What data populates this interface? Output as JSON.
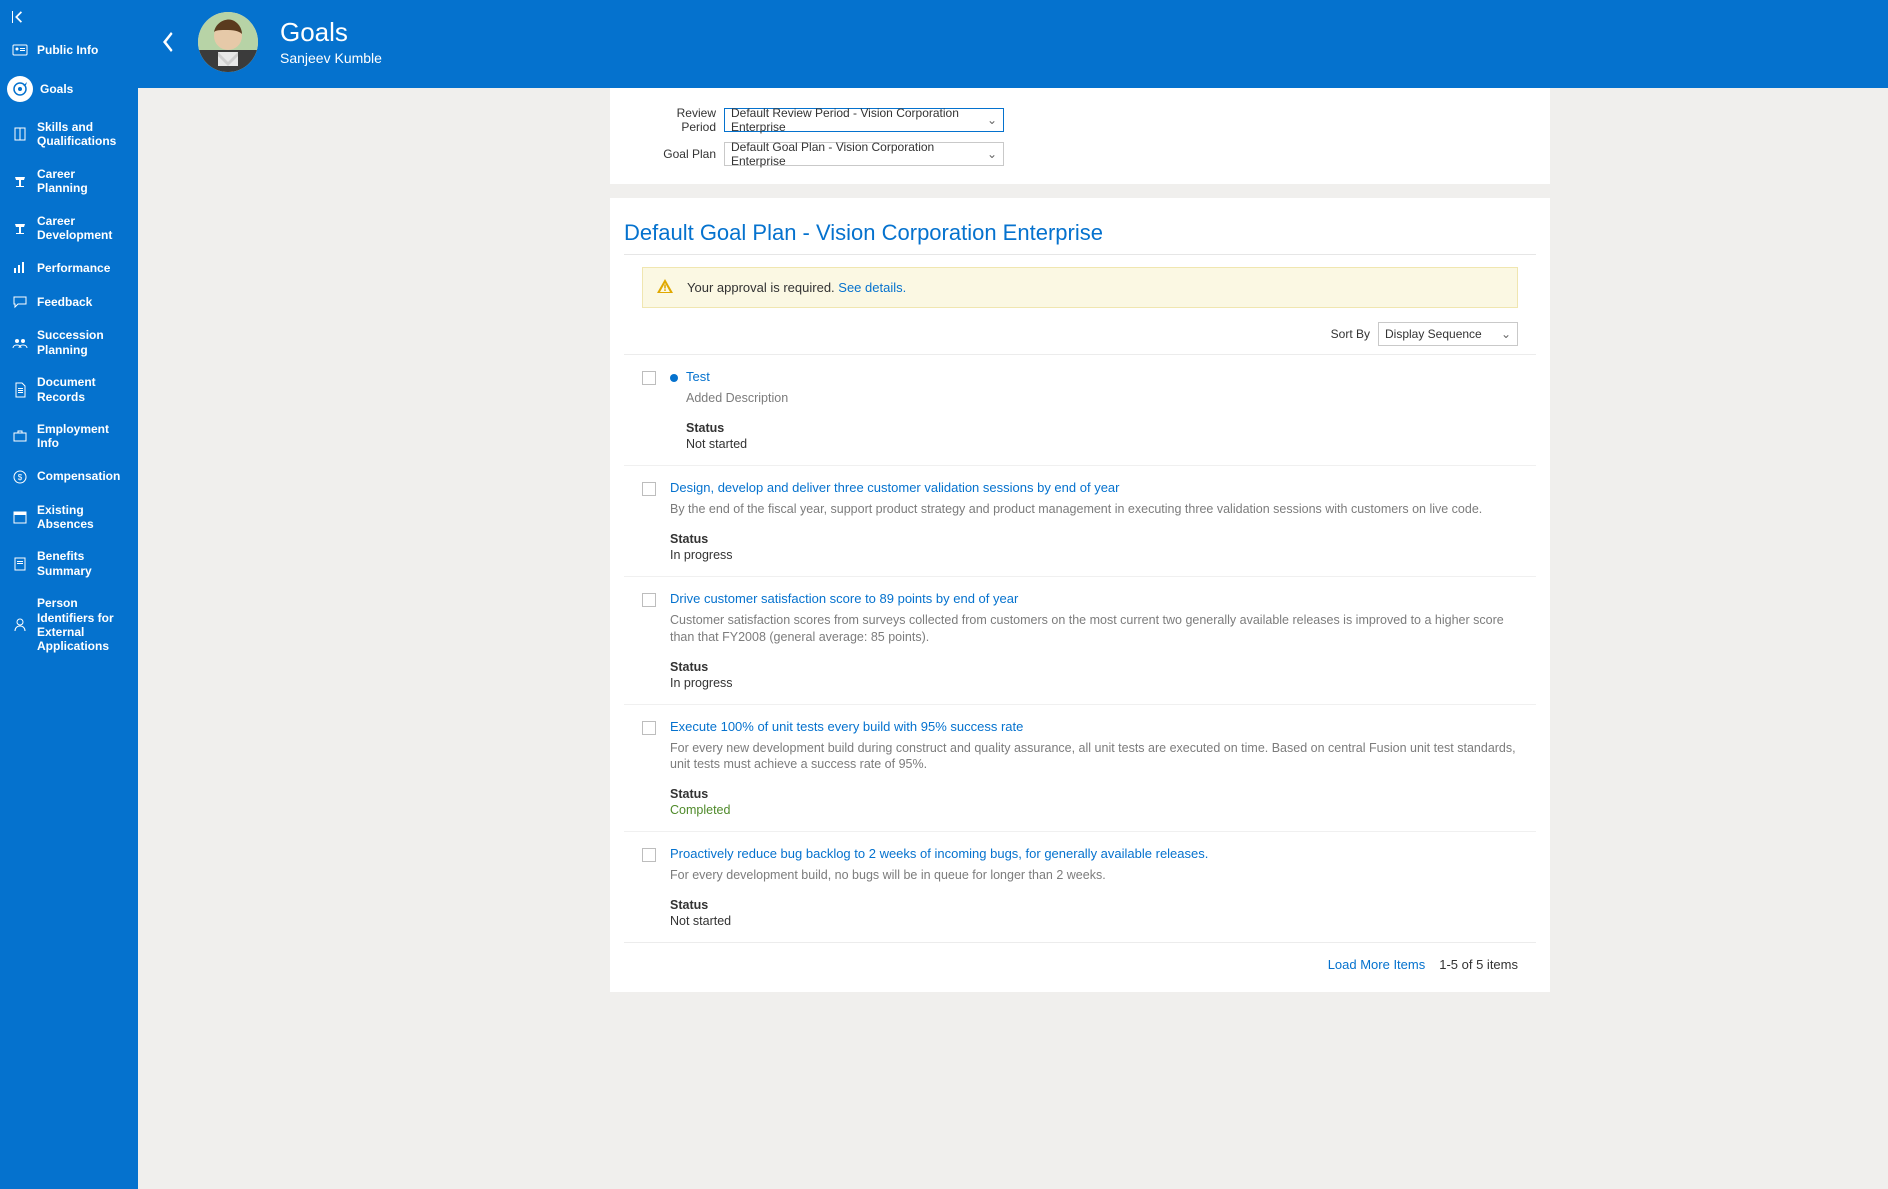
{
  "sidebar": {
    "items": [
      {
        "label": "Public Info",
        "icon": "card-icon"
      },
      {
        "label": "Goals",
        "icon": "target-icon",
        "active": true
      },
      {
        "label": "Skills and Qualifications",
        "icon": "book-icon"
      },
      {
        "label": "Career Planning",
        "icon": "lectern-icon"
      },
      {
        "label": "Career Development",
        "icon": "lectern2-icon"
      },
      {
        "label": "Performance",
        "icon": "chart-icon"
      },
      {
        "label": "Feedback",
        "icon": "chat-icon"
      },
      {
        "label": "Succession Planning",
        "icon": "people-icon"
      },
      {
        "label": "Document Records",
        "icon": "doc-icon"
      },
      {
        "label": "Employment Info",
        "icon": "briefcase-icon"
      },
      {
        "label": "Compensation",
        "icon": "money-icon"
      },
      {
        "label": "Existing Absences",
        "icon": "absence-icon"
      },
      {
        "label": "Benefits Summary",
        "icon": "benefits-icon"
      },
      {
        "label": "Person Identifiers for External Applications",
        "icon": "id-icon"
      }
    ]
  },
  "header": {
    "title": "Goals",
    "subtitle": "Sanjeev Kumble"
  },
  "filters": {
    "review_period_label": "Review Period",
    "review_period_value": "Default Review Period - Vision Corporation Enterprise",
    "goal_plan_label": "Goal Plan",
    "goal_plan_value": "Default Goal Plan - Vision Corporation Enterprise"
  },
  "plan": {
    "title": "Default Goal Plan - Vision Corporation Enterprise",
    "alert_text": "Your approval is required. ",
    "alert_link": "See details.",
    "sort_by_label": "Sort By",
    "sort_by_value": "Display Sequence",
    "status_label": "Status",
    "load_more_label": "Load More Items",
    "counter": "1-5 of 5 items",
    "goals": [
      {
        "title": "Test",
        "has_dot": true,
        "description": "Added Description",
        "status": "Not started"
      },
      {
        "title": "Design, develop and deliver three customer validation sessions by end of year",
        "description": "By the end of the fiscal year, support product strategy and product management in executing three validation sessions with customers on live code.",
        "status": "In progress"
      },
      {
        "title": "Drive customer satisfaction score to 89 points by end of year",
        "description": "Customer satisfaction scores from surveys collected from customers on the most current two generally available releases is improved to a higher score than that FY2008 (general average: 85 points).",
        "status": "In progress"
      },
      {
        "title": "Execute 100% of unit tests every build with 95% success rate",
        "description": "For every new development build during construct and quality assurance, all unit tests are executed on time. Based on central Fusion unit test standards, unit tests must achieve a success rate of 95%.",
        "status": "Completed",
        "status_class": "completed"
      },
      {
        "title": "Proactively reduce bug backlog to 2 weeks of incoming bugs, for generally available releases.",
        "description": "For every development build, no bugs will be in queue for longer than 2 weeks.",
        "status": "Not started"
      }
    ]
  }
}
